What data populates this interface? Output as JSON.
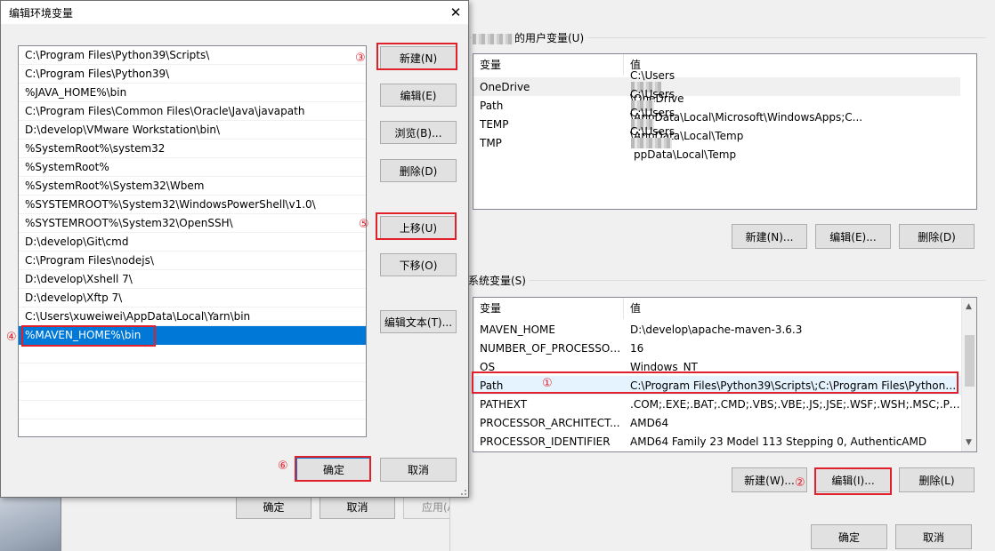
{
  "edit_dialog": {
    "title": "编辑环境变量",
    "close_glyph": "✕",
    "path_items": [
      "C:\\Program Files\\Python39\\Scripts\\",
      "C:\\Program Files\\Python39\\",
      "%JAVA_HOME%\\bin",
      "C:\\Program Files\\Common Files\\Oracle\\Java\\javapath",
      "D:\\develop\\VMware Workstation\\bin\\",
      "%SystemRoot%\\system32",
      "%SystemRoot%",
      "%SystemRoot%\\System32\\Wbem",
      "%SYSTEMROOT%\\System32\\WindowsPowerShell\\v1.0\\",
      "%SYSTEMROOT%\\System32\\OpenSSH\\",
      "D:\\develop\\Git\\cmd",
      "C:\\Program Files\\nodejs\\",
      "D:\\develop\\Xshell 7\\",
      "D:\\develop\\Xftp 7\\",
      "C:\\Users\\xuweiwei\\AppData\\Local\\Yarn\\bin",
      "%MAVEN_HOME%\\bin"
    ],
    "buttons": {
      "new": "新建(N)",
      "edit": "编辑(E)",
      "browse": "浏览(B)...",
      "delete": "删除(D)",
      "move_up": "上移(U)",
      "move_down": "下移(O)",
      "edit_text": "编辑文本(T)...",
      "ok": "确定",
      "cancel": "取消"
    }
  },
  "background_props": {
    "ok": "确定",
    "cancel": "取消",
    "apply": "应用(A)"
  },
  "env_window": {
    "user_group_title": "的用户变量(U)",
    "user_columns": [
      "变量",
      "值"
    ],
    "user_vars": [
      {
        "name": "OneDrive",
        "value_pre": "C:\\Users",
        "value_post": "\\OneDrive"
      },
      {
        "name": "Path",
        "value_pre": "C:\\Users",
        "value_post": "\\AppData\\Local\\Microsoft\\WindowsApps;C..."
      },
      {
        "name": "TEMP",
        "value_pre": "C:\\Users",
        "value_post": "\\AppData\\Local\\Temp"
      },
      {
        "name": "TMP",
        "value_pre": "C:\\Users",
        "value_post": "ppData\\Local\\Temp"
      }
    ],
    "user_buttons": {
      "new": "新建(N)...",
      "edit": "编辑(E)...",
      "delete": "删除(D)"
    },
    "system_group_title": "系统变量(S)",
    "system_columns": [
      "变量",
      "值"
    ],
    "system_vars": [
      {
        "name": "MAVEN_HOME",
        "value": "D:\\develop\\apache-maven-3.6.3"
      },
      {
        "name": "NUMBER_OF_PROCESSORS",
        "value": "16"
      },
      {
        "name": "OS",
        "value": "Windows_NT"
      },
      {
        "name": "Path",
        "value": "C:\\Program Files\\Python39\\Scripts\\;C:\\Program Files\\Python3..."
      },
      {
        "name": "PATHEXT",
        "value": ".COM;.EXE;.BAT;.CMD;.VBS;.VBE;.JS;.JSE;.WSF;.WSH;.MSC;.PY;.P..."
      },
      {
        "name": "PROCESSOR_ARCHITECT...",
        "value": "AMD64"
      },
      {
        "name": "PROCESSOR_IDENTIFIER",
        "value": "AMD64 Family 23 Model 113 Stepping 0, AuthenticAMD"
      }
    ],
    "system_buttons": {
      "new": "新建(W)...",
      "edit": "编辑(I)...",
      "delete": "删除(L)"
    },
    "ok": "确定",
    "cancel": "取消"
  },
  "annotations": [
    "①",
    "②",
    "③",
    "④",
    "⑤",
    "⑥"
  ],
  "annotation_color": "#e0202a",
  "selection_color": "#0078d7"
}
